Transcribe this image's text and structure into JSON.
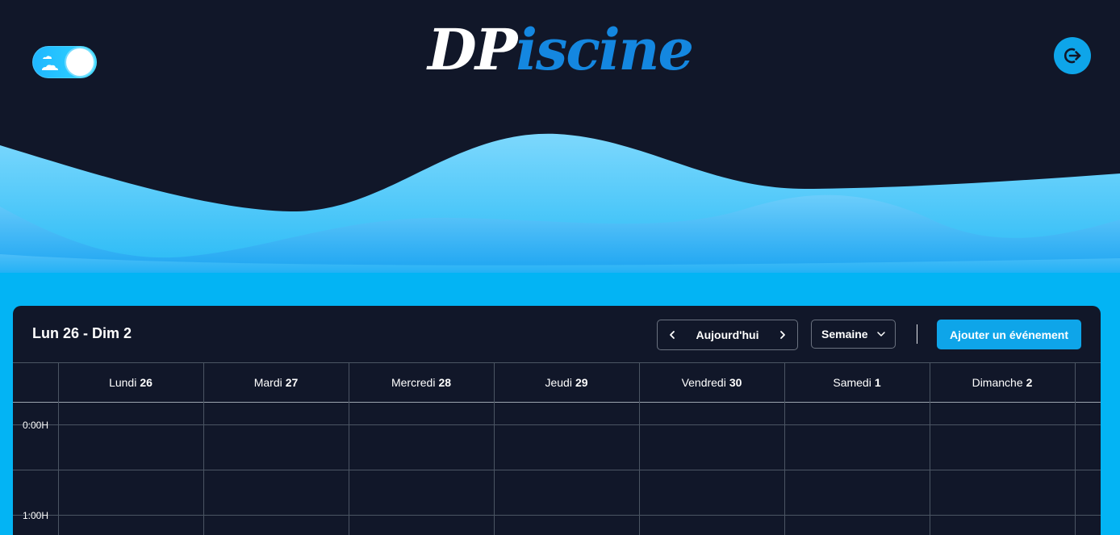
{
  "header": {
    "logo_part1": "DP",
    "logo_part2": "iscine",
    "theme_toggle_icon": "cloud-icon",
    "logout_icon": "logout-icon"
  },
  "colors": {
    "background": "#111729",
    "accent": "#0ea5e9",
    "water": "#03b4f4",
    "logo_blue": "#1487e0"
  },
  "calendar": {
    "range_title": "Lun 26 - Dim 2",
    "today_label": "Aujourd'hui",
    "view_label": "Semaine",
    "add_event_label": "Ajouter un événement",
    "days": [
      {
        "name": "Lundi",
        "num": "26"
      },
      {
        "name": "Mardi",
        "num": "27"
      },
      {
        "name": "Mercredi",
        "num": "28"
      },
      {
        "name": "Jeudi",
        "num": "29"
      },
      {
        "name": "Vendredi",
        "num": "30"
      },
      {
        "name": "Samedi",
        "num": "1"
      },
      {
        "name": "Dimanche",
        "num": "2"
      }
    ],
    "times": [
      "0:00H",
      "1:00H"
    ]
  }
}
